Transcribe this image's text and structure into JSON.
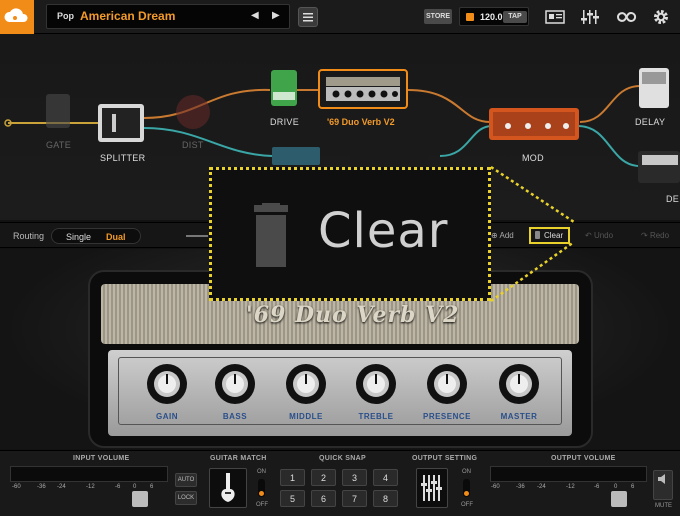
{
  "topbar": {
    "preset_genre": "Pop",
    "preset_name": "American Dream",
    "prev_glyph": "◀",
    "next_glyph": "▶",
    "store_label": "STORE",
    "tempo": "120.0",
    "tap_label": "TAP"
  },
  "chain": {
    "gate_label": "GATE",
    "splitter_label": "SPLITTER",
    "dist_label": "DIST",
    "drive_label": "DRIVE",
    "amp_label": "'69 Duo Verb V2",
    "mod_label": "MOD",
    "delay_label": "DELAY",
    "de_label": "DE"
  },
  "routing": {
    "label": "Routing",
    "single": "Single",
    "dual": "Dual",
    "add": "Add",
    "clear": "Clear",
    "undo": "Undo",
    "redo": "Redo"
  },
  "amp": {
    "logo": "'69 Duo Verb V2",
    "knobs": [
      "GAIN",
      "BASS",
      "MIDDLE",
      "TREBLE",
      "PRESENCE",
      "MASTER"
    ]
  },
  "bottom": {
    "input_volume": "INPUT VOLUME",
    "guitar_match": "GUITAR MATCH",
    "quick_snap": "QUICK SNAP",
    "output_setting": "OUTPUT SETTING",
    "output_volume": "OUTPUT VOLUME",
    "auto": "AUTO",
    "lock": "LOCK",
    "on": "ON",
    "off": "OFF",
    "mute": "MUTE",
    "scale": [
      "-60",
      "-36",
      "-24",
      "-12",
      "-6",
      "0",
      "6"
    ],
    "snaps": [
      "1",
      "2",
      "3",
      "4",
      "5",
      "6",
      "7",
      "8"
    ]
  },
  "zoom": {
    "text": "Clear"
  },
  "colors": {
    "accent": "#f28c18",
    "highlight": "#e8d12b"
  }
}
